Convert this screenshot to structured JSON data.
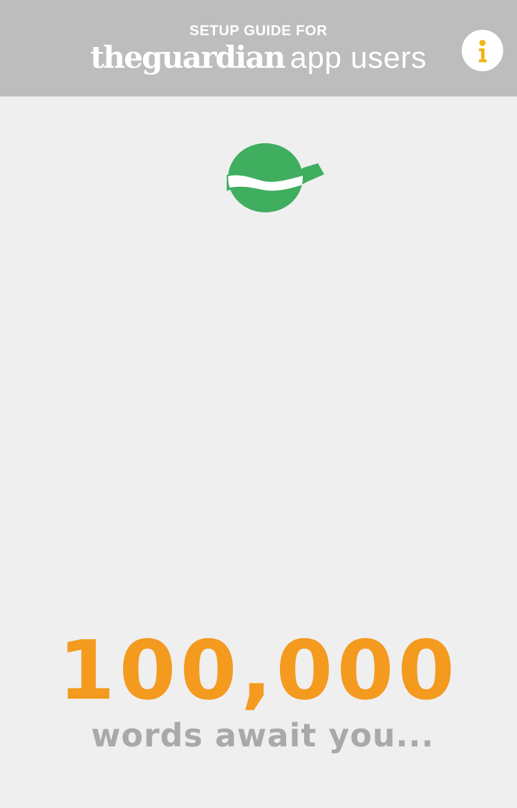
{
  "header": {
    "subtitle": "SETUP GUIDE FOR",
    "brand": "theguardian",
    "tagline": "app users",
    "info_icon": "info-icon"
  },
  "logo": {
    "icon": "wave-globe-logo-icon",
    "color": "#3fae5f"
  },
  "main": {
    "count": "100,000",
    "caption": "words await you..."
  },
  "colors": {
    "header_bg": "#bdbdbd",
    "page_bg": "#efefef",
    "accent_orange": "#f39a1f",
    "caption_gray": "#a9a9a9",
    "info_yellow": "#f2b418",
    "logo_green": "#3fae5f"
  }
}
